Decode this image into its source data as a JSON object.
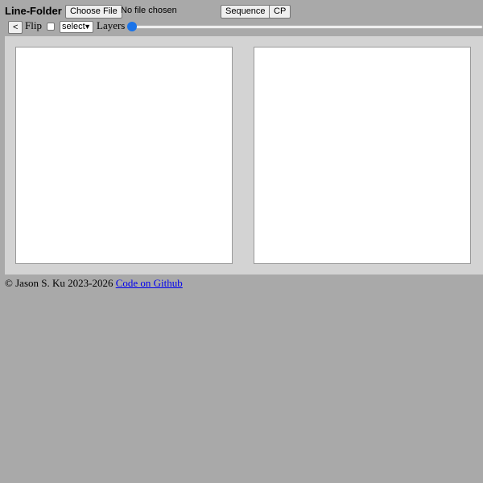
{
  "header": {
    "title": "Line-Folder",
    "choose_file_label": "Choose File",
    "file_status": "No file chosen",
    "sequence_label": "Sequence",
    "cp_label": "CP"
  },
  "toolbar": {
    "back_label": "<",
    "flip_label": "Flip",
    "flip_checked": false,
    "select_value": "select",
    "layers_label": "Layers",
    "layers_slider_value": 0
  },
  "footer": {
    "copyright": "© Jason S. Ku 2023-2026",
    "github_link": "Code on Github"
  },
  "colors": {
    "page_background": "#a9a9a9",
    "workspace_background": "#d3d3d3",
    "panel_background": "#ffffff",
    "slider_accent": "#1a73e8",
    "link": "#0000ee"
  }
}
